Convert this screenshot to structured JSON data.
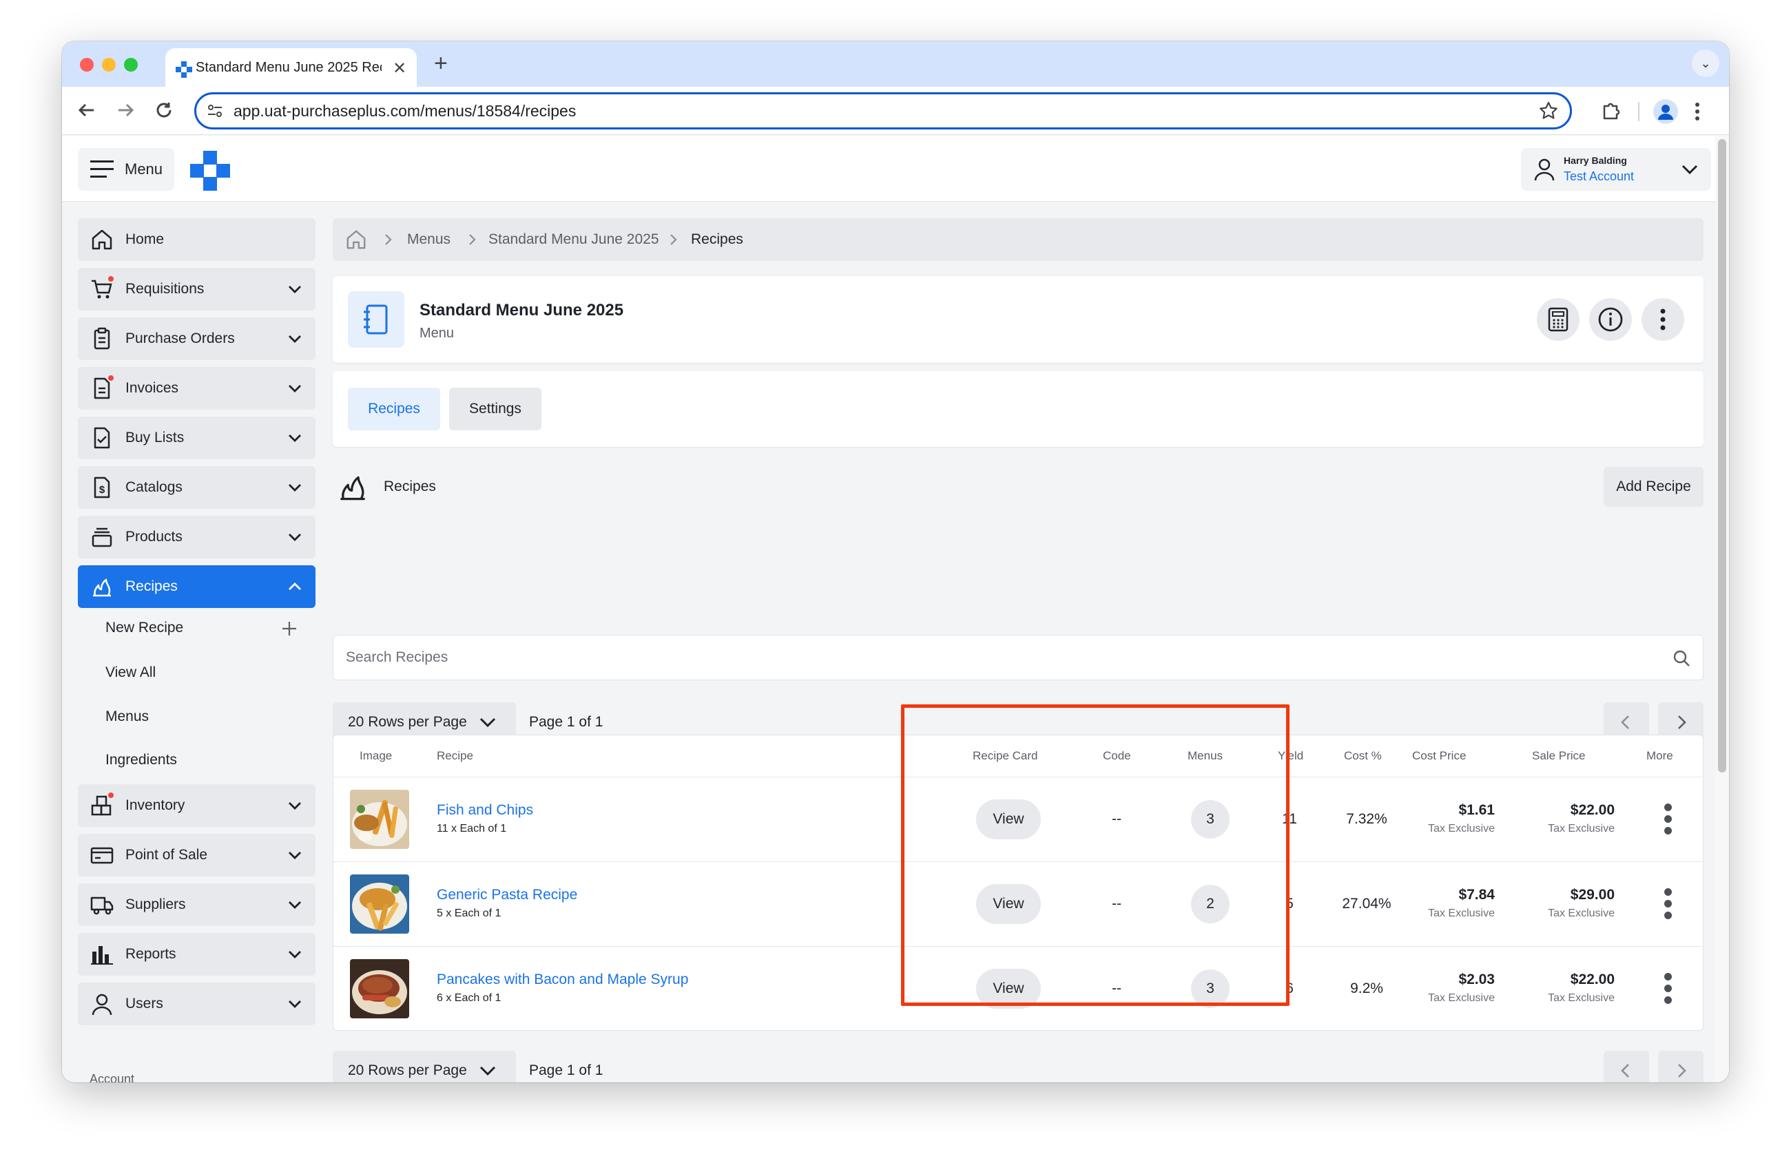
{
  "browser": {
    "tab_title": "Standard Menu June 2025 Recipes",
    "url": "app.uat-purchaseplus.com/menus/18584/recipes"
  },
  "header": {
    "menu_label": "Menu",
    "user_name": "Harry Balding",
    "user_account": "Test Account"
  },
  "sidebar": {
    "items": [
      {
        "label": "Home"
      },
      {
        "label": "Requisitions"
      },
      {
        "label": "Purchase Orders"
      },
      {
        "label": "Invoices"
      },
      {
        "label": "Buy Lists"
      },
      {
        "label": "Catalogs"
      },
      {
        "label": "Products"
      },
      {
        "label": "Recipes"
      },
      {
        "label": "Inventory"
      },
      {
        "label": "Point of Sale"
      },
      {
        "label": "Suppliers"
      },
      {
        "label": "Reports"
      },
      {
        "label": "Users"
      }
    ],
    "recipes_sub": [
      "New Recipe",
      "View All",
      "Menus",
      "Ingredients"
    ],
    "section_label": "Account"
  },
  "breadcrumb": [
    "Menus",
    "Standard Menu June 2025",
    "Recipes"
  ],
  "menu_card": {
    "title": "Standard Menu June 2025",
    "subtitle": "Menu"
  },
  "tabs": [
    "Recipes",
    "Settings"
  ],
  "section": {
    "title": "Recipes",
    "add_button": "Add Recipe"
  },
  "search": {
    "placeholder": "Search Recipes"
  },
  "pagination": {
    "rows_per_page": "20 Rows per Page",
    "page_text": "Page 1 of 1"
  },
  "table": {
    "columns": [
      "Image",
      "Recipe",
      "Recipe Card",
      "Code",
      "Menus",
      "Yield",
      "Cost %",
      "Cost Price",
      "Sale Price",
      "More"
    ],
    "rows": [
      {
        "name": "Fish and Chips",
        "sub": "11 x Each of 1",
        "card": "View",
        "code": "--",
        "menus": "3",
        "yield": "11",
        "cost_pct": "7.32%",
        "cost_price": "$1.61",
        "cost_note": "Tax Exclusive",
        "sale_price": "$22.00",
        "sale_note": "Tax Exclusive"
      },
      {
        "name": "Generic Pasta Recipe",
        "sub": "5 x Each of 1",
        "card": "View",
        "code": "--",
        "menus": "2",
        "yield": "5",
        "cost_pct": "27.04%",
        "cost_price": "$7.84",
        "cost_note": "Tax Exclusive",
        "sale_price": "$29.00",
        "sale_note": "Tax Exclusive"
      },
      {
        "name": "Pancakes with Bacon and Maple Syrup",
        "sub": "6 x Each of 1",
        "card": "View",
        "code": "--",
        "menus": "3",
        "yield": "6",
        "cost_pct": "9.2%",
        "cost_price": "$2.03",
        "cost_note": "Tax Exclusive",
        "sale_price": "$22.00",
        "sale_note": "Tax Exclusive"
      }
    ]
  },
  "colors": {
    "accent": "#1a73e8",
    "highlight": "#f0380f",
    "notification": "#ef4444"
  }
}
